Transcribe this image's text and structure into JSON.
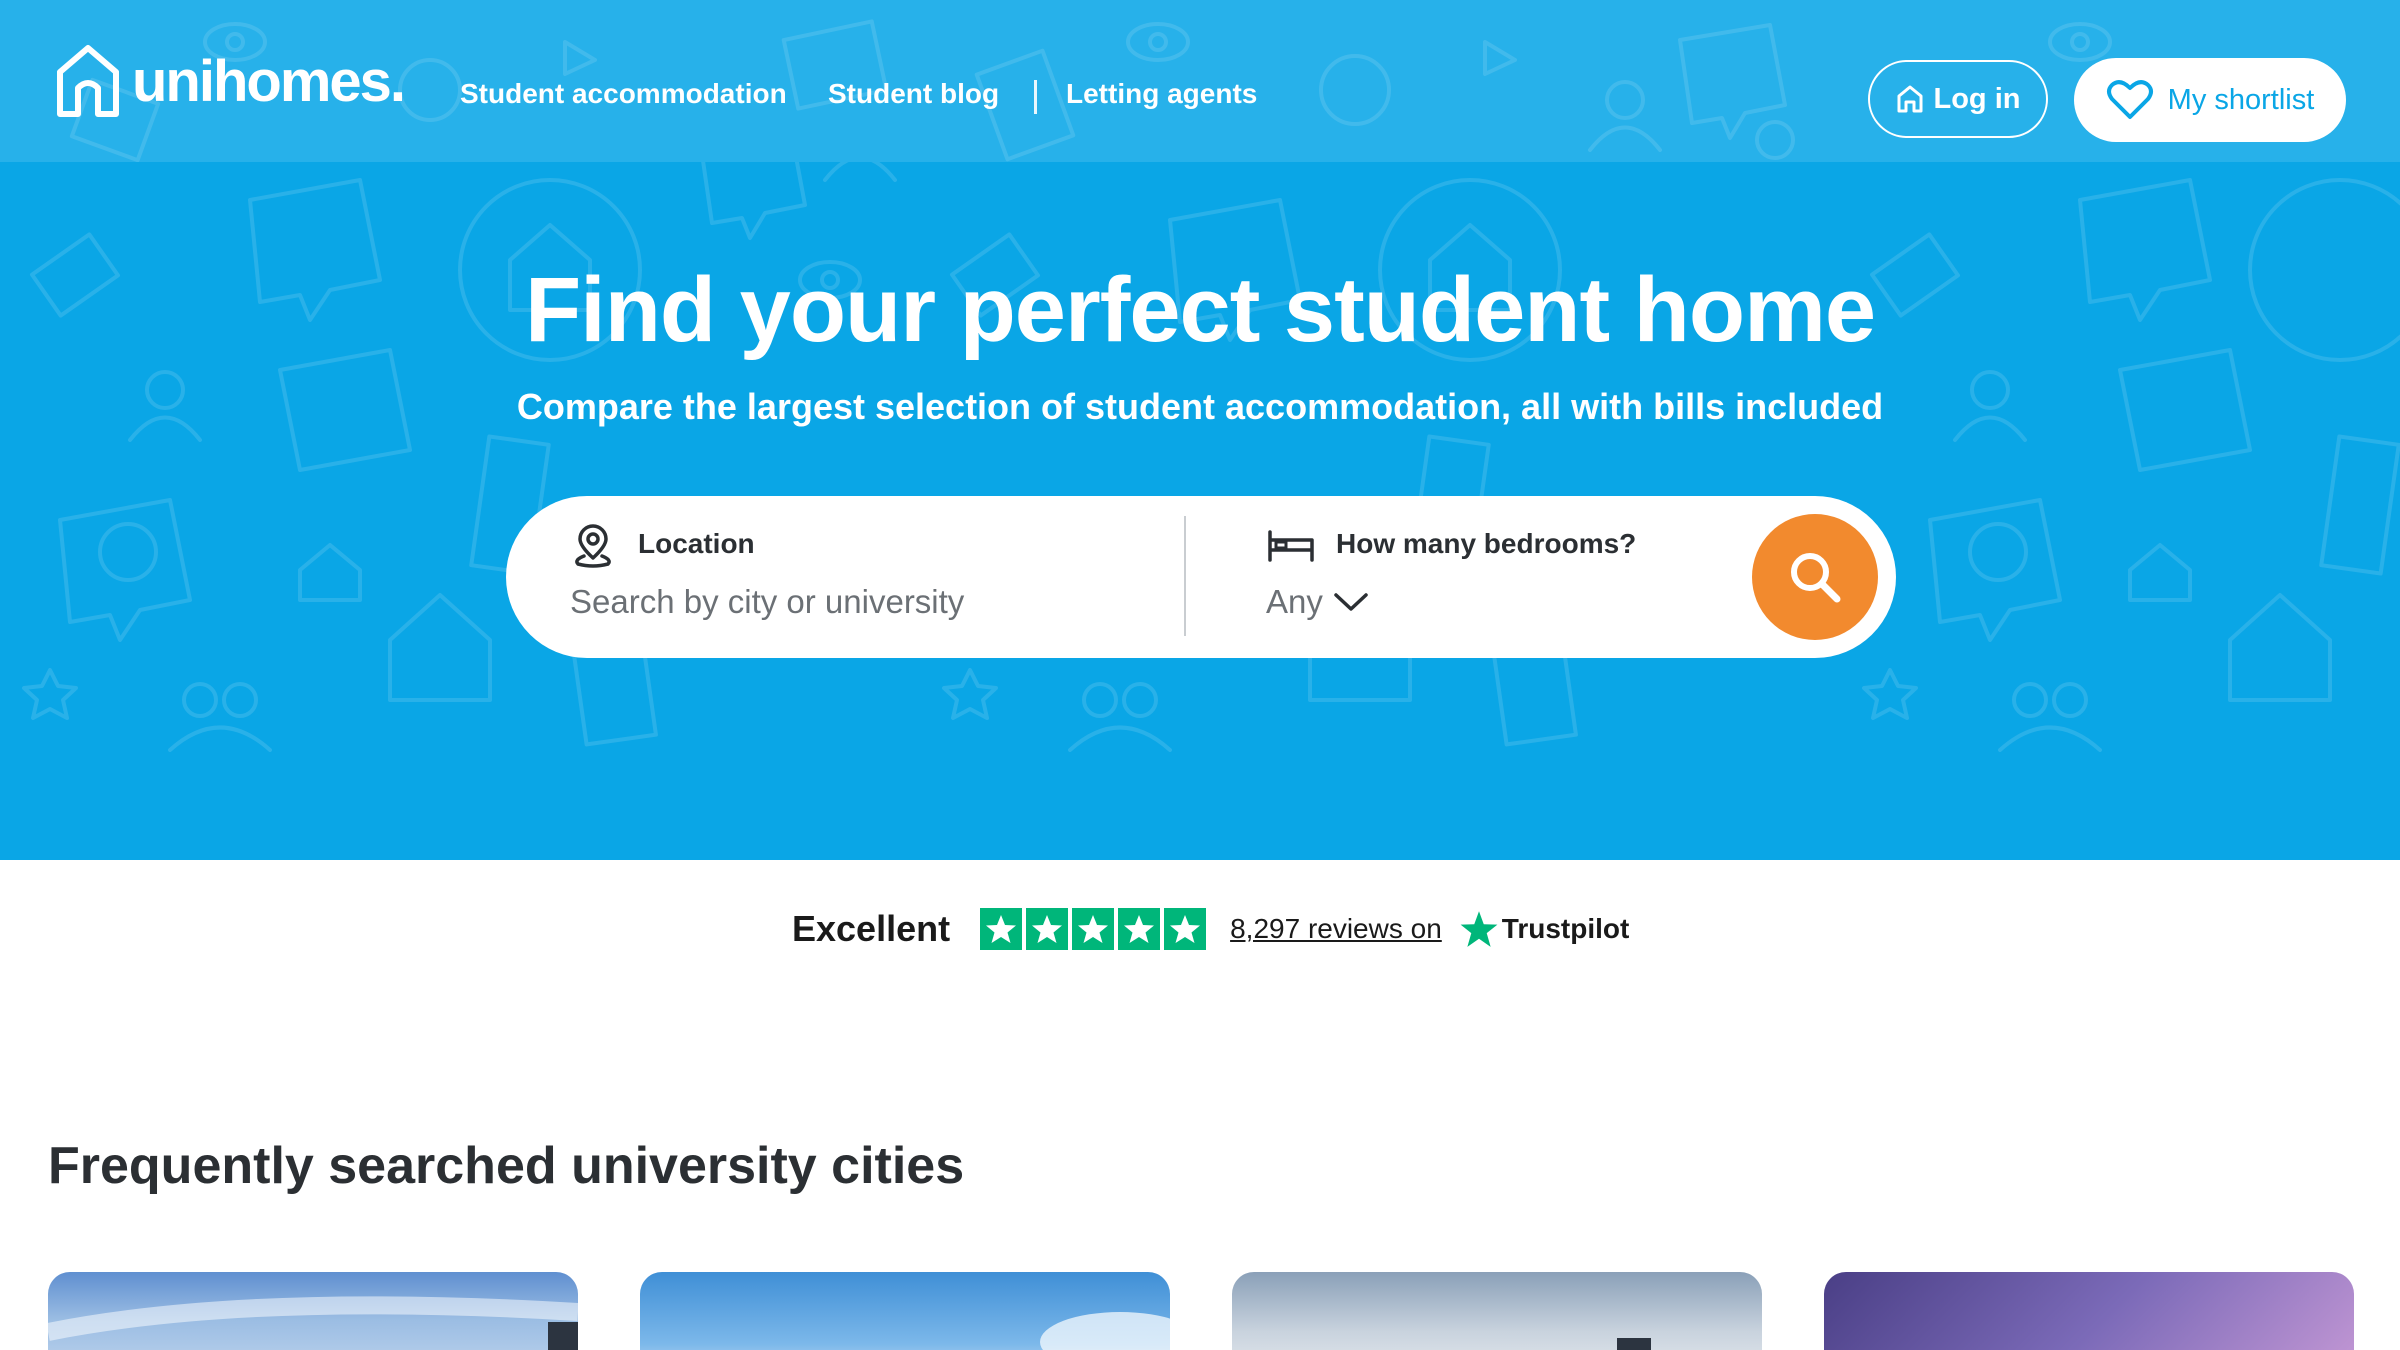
{
  "nav": {
    "logo_text": "unihomes.",
    "links": [
      "Student accommodation",
      "Student blog",
      "Letting agents"
    ],
    "login_label": "Log in",
    "shortlist_label": "My shortlist"
  },
  "hero": {
    "title": "Find your perfect student home",
    "subtitle": "Compare the largest selection of student accommodation, all with bills included"
  },
  "search": {
    "location_label": "Location",
    "location_placeholder": "Search by city or university",
    "bedrooms_label": "How many bedrooms?",
    "bedrooms_value": "Any"
  },
  "trustpilot": {
    "rating_word": "Excellent",
    "stars": 5,
    "reviews_text": "8,297 reviews on",
    "brand": "Trustpilot"
  },
  "cities": {
    "section_title": "Frequently searched university cities"
  },
  "colors": {
    "hero_blue": "#0aa6e6",
    "nav_blue": "#27b1ea",
    "search_orange": "#f28a2e",
    "trustpilot_green": "#00b67a"
  },
  "icons": [
    "house-logo-icon",
    "home-icon",
    "heart-icon",
    "location-pin-icon",
    "bed-icon",
    "chevron-down-icon",
    "search-icon",
    "star-icon"
  ]
}
